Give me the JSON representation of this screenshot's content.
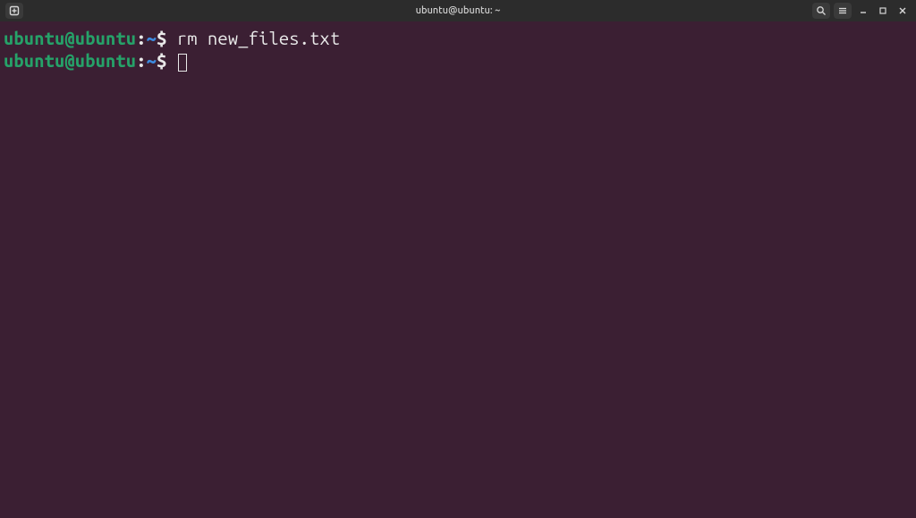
{
  "titlebar": {
    "title": "ubuntu@ubuntu: ~"
  },
  "terminal": {
    "lines": [
      {
        "userhost": "ubuntu@ubuntu",
        "colon": ":",
        "path": "~",
        "dollar": "$",
        "command": "rm new_files.txt"
      },
      {
        "userhost": "ubuntu@ubuntu",
        "colon": ":",
        "path": "~",
        "dollar": "$",
        "command": ""
      }
    ]
  }
}
